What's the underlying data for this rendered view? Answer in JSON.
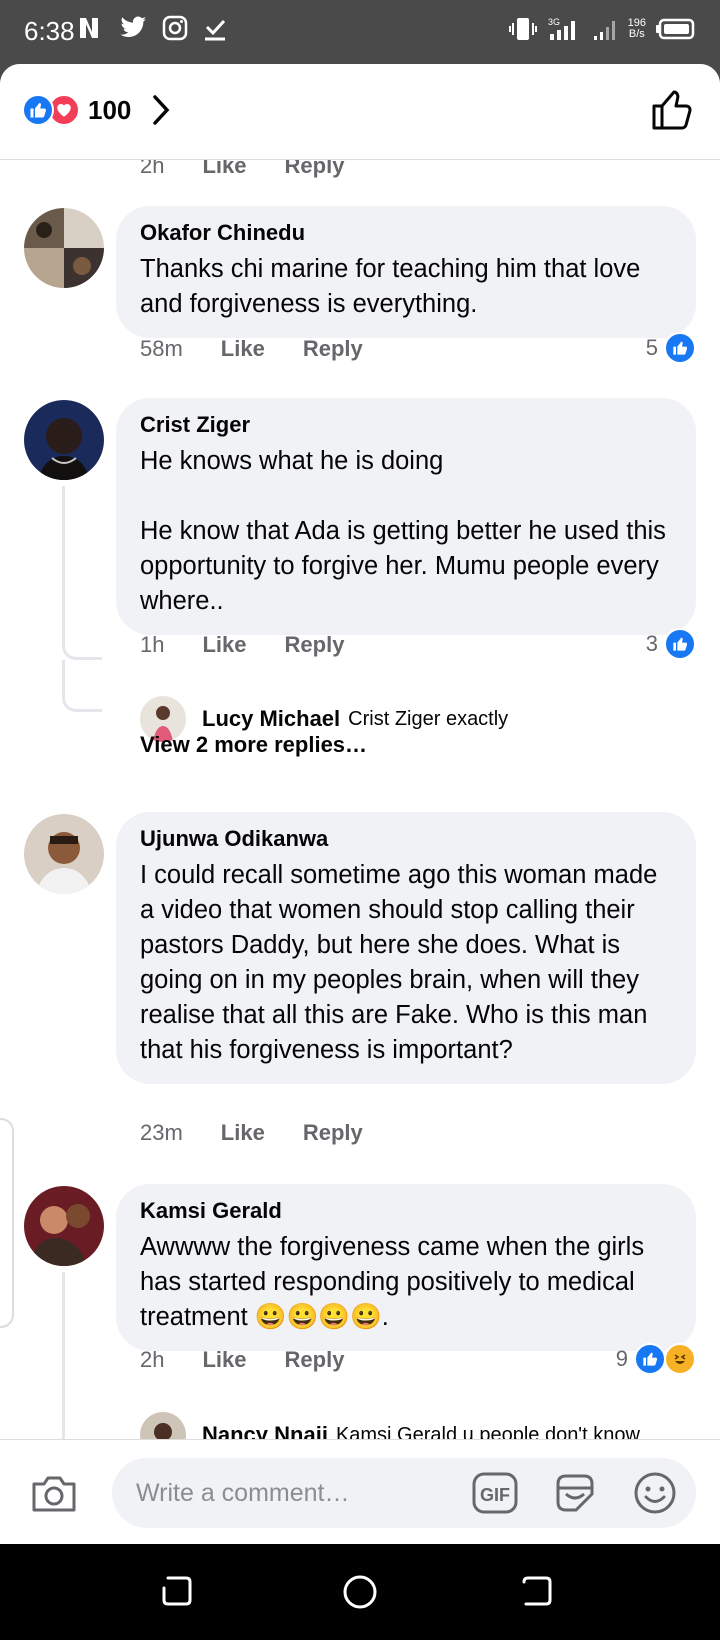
{
  "status_bar": {
    "time": "6:38",
    "speed_value": "196",
    "speed_unit": "B/s"
  },
  "header": {
    "reaction_count": "100",
    "reaction_icons": [
      "like-reaction-icon",
      "love-reaction-icon"
    ]
  },
  "comments": [
    {
      "meta": {
        "time": "2h",
        "like": "Like",
        "reply": "Reply"
      }
    },
    {
      "author": "Okafor Chinedu",
      "text": "Thanks chi marine for teaching him that love and forgiveness is everything.",
      "meta": {
        "time": "58m",
        "like": "Like",
        "reply": "Reply"
      },
      "reactions": "5"
    },
    {
      "author": "Crist Ziger",
      "text": "He knows what he is doing\n\nHe know that Ada is getting better he used this opportunity to forgive her. Mumu people every where..",
      "meta": {
        "time": "1h",
        "like": "Like",
        "reply": "Reply"
      },
      "reactions": "3",
      "reply": {
        "author": "Lucy Michael",
        "text": "Crist Ziger exactly"
      },
      "more_replies": "View 2 more replies…"
    },
    {
      "author": "Ujunwa Odikanwa",
      "text": "I could recall sometime ago this woman made a video that women should stop calling their pastors Daddy, but here she does. What is going on in my peoples brain, when will they realise that all this are Fake. Who is this man that his forgiveness is important?",
      "meta": {
        "time": "23m",
        "like": "Like",
        "reply": "Reply"
      }
    },
    {
      "author": "Kamsi Gerald",
      "text": "Awwww the forgiveness came when the girls has started responding positively to medical treatment 😀😀😀😀.",
      "meta": {
        "time": "2h",
        "like": "Like",
        "reply": "Reply"
      },
      "reactions": "9",
      "reply": {
        "author": "Nancy Nnaji",
        "text": "Kamsi Gerald u people don't know"
      }
    }
  ],
  "composer": {
    "placeholder": "Write a comment…",
    "gif_label": "GIF"
  },
  "colors": {
    "facebook_blue": "#1877f2",
    "love_red": "#f33e58",
    "bubble_gray": "#f0f2f5",
    "meta_gray": "#65676b"
  }
}
